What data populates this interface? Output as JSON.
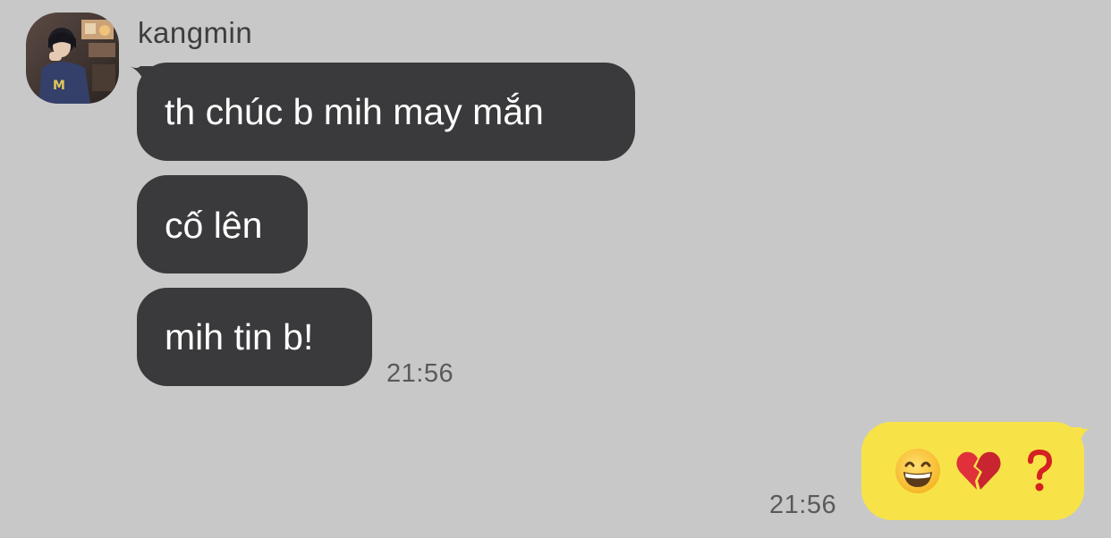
{
  "chat": {
    "sender": {
      "name": "kangmin",
      "avatar_icon": "profile-photo"
    },
    "incoming_messages": [
      {
        "text": "th chúc b mih may mắn"
      },
      {
        "text": "cố lên"
      },
      {
        "text": "mih tin b!"
      }
    ],
    "incoming_time": "21:56",
    "outgoing": {
      "emojis": [
        "grinning-face-with-smiling-eyes",
        "broken-heart",
        "red-question-mark"
      ],
      "time": "21:56"
    }
  },
  "colors": {
    "background": "#c8c8c8",
    "incoming_bubble": "#3a3a3c",
    "outgoing_bubble": "#f7e348",
    "incoming_text": "#ffffff",
    "timestamp": "#5a5a5a"
  }
}
